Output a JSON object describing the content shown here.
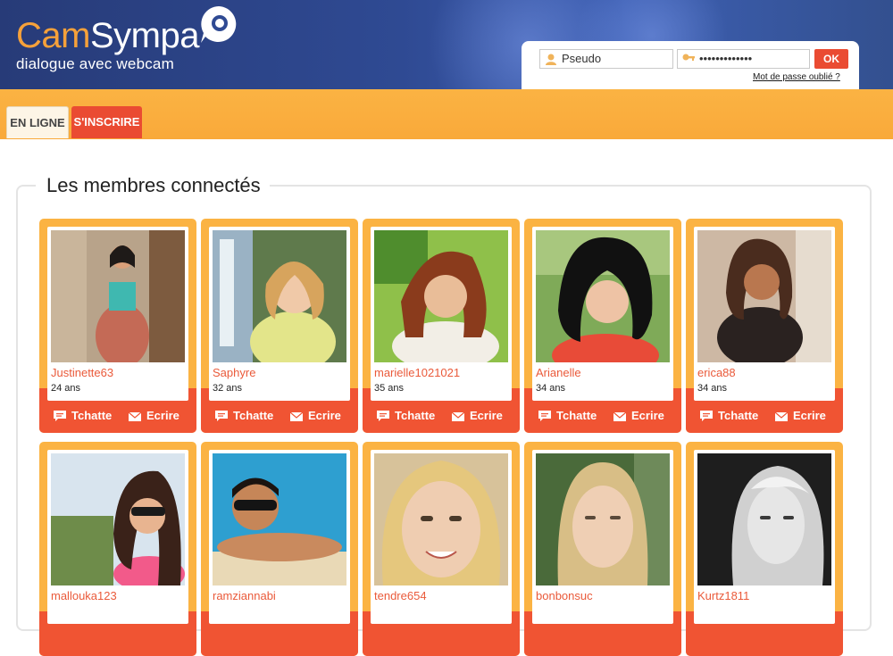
{
  "brand": {
    "name_part1": "Cam",
    "name_part2": "Sympa",
    "tagline": "dialogue avec webcam",
    "accent": "#f6a13a"
  },
  "login": {
    "pseudo_value": "Pseudo",
    "password_value": "•••••••••••••",
    "ok_label": "OK",
    "forgot_label": "Mot de passe oublié ?"
  },
  "nav": {
    "tabs": [
      {
        "label": "EN LIGNE"
      },
      {
        "label": "S'INSCRIRE"
      }
    ]
  },
  "section": {
    "title": "Les membres connectés"
  },
  "actions": {
    "chat_label": "Tchatte",
    "mail_label": "Ecrire"
  },
  "members": [
    {
      "name": "Justinette63",
      "age": "24 ans"
    },
    {
      "name": "Saphyre",
      "age": "32 ans"
    },
    {
      "name": "marielle1021021",
      "age": "35 ans"
    },
    {
      "name": "Arianelle",
      "age": "34 ans"
    },
    {
      "name": "erica88",
      "age": "34 ans"
    },
    {
      "name": "mallouka123",
      "age": ""
    },
    {
      "name": "ramziannabi",
      "age": ""
    },
    {
      "name": "tendre654",
      "age": ""
    },
    {
      "name": "bonbonsuc",
      "age": ""
    },
    {
      "name": "Kurtz1811",
      "age": ""
    }
  ],
  "colors": {
    "header_blue": "#2f4a93",
    "nav_orange": "#fbb343",
    "action_red": "#f05433",
    "username": "#ea5a3a"
  }
}
